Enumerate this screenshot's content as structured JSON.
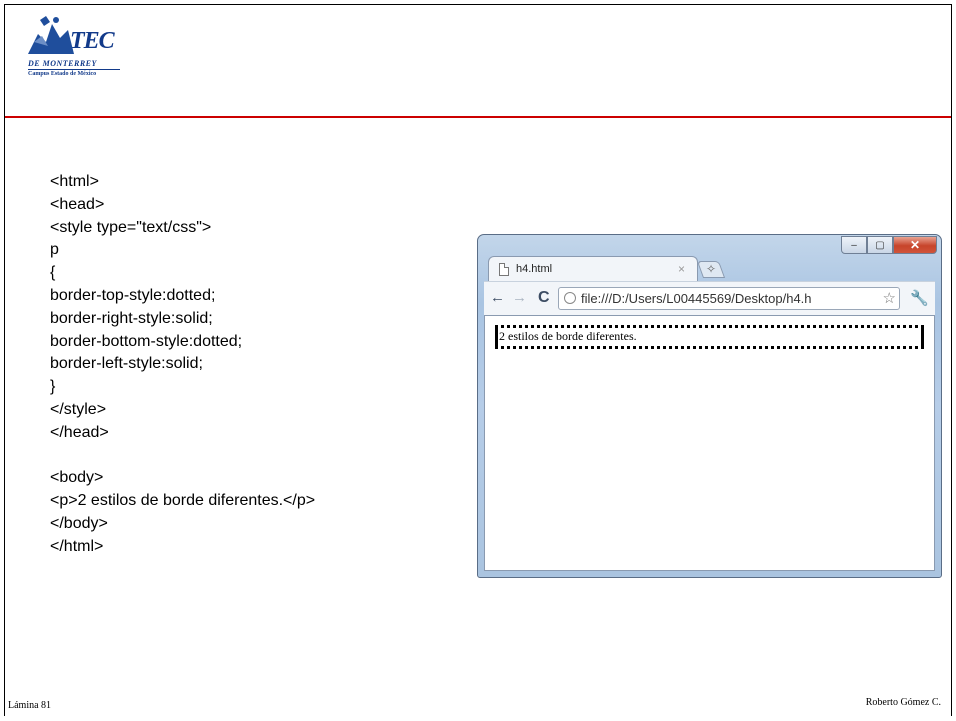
{
  "slide": {
    "logo": {
      "wordmark": "TEC",
      "line1": "DE MONTERREY",
      "line2": "Campus Estado de México"
    },
    "code_lines": [
      "<html>",
      "<head>",
      "<style type=\"text/css\">",
      "p",
      "{",
      "border-top-style:dotted;",
      "border-right-style:solid;",
      "border-bottom-style:dotted;",
      "border-left-style:solid;",
      "}",
      "</style>",
      "</head>",
      "",
      "<body>",
      "<p>2 estilos de borde diferentes.</p>",
      "</body>",
      "</html>"
    ],
    "footer_left": "Lámina 81",
    "footer_right": "Roberto Gómez C.",
    "rule_color": "#cc0000"
  },
  "browser": {
    "tab_title": "h4.html",
    "tab_close": "×",
    "new_tab": "✧",
    "url": "file:///D:/Users/L00445569/Desktop/h4.h",
    "paragraph": "2 estilos de borde diferentes.",
    "window_buttons": {
      "minimize": "–",
      "maximize": "▢",
      "close": "✕"
    }
  }
}
